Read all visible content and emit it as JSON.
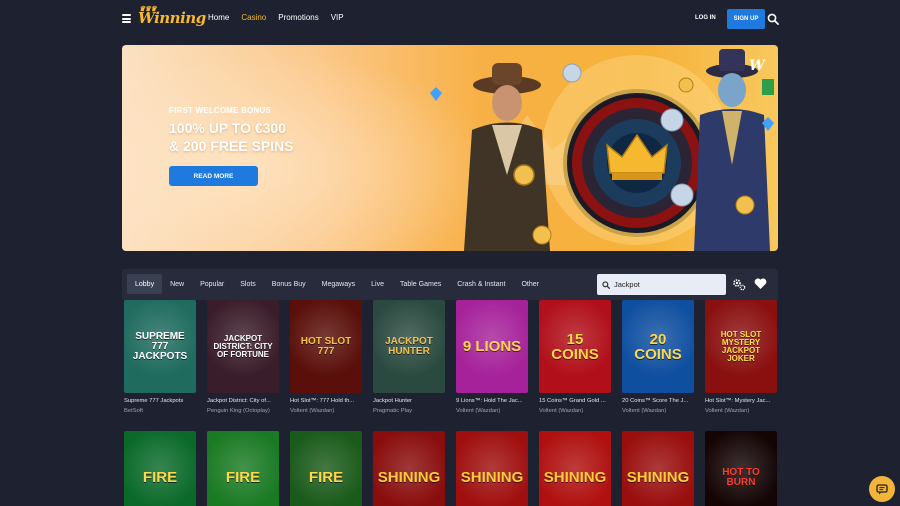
{
  "header": {
    "logo_text": "Winning",
    "nav": [
      {
        "label": "Home",
        "active": false
      },
      {
        "label": "Casino",
        "active": true
      },
      {
        "label": "Promotions",
        "active": false
      },
      {
        "label": "VIP",
        "active": false
      }
    ],
    "login_label": "LOG IN",
    "signup_label": "SIGN UP"
  },
  "banner": {
    "subtitle": "FIRST WELCOME BONUS",
    "headline_1": "100% UP TO €300",
    "headline_2": "& 200 FREE SPINS",
    "cta_label": "READ MORE"
  },
  "filters": {
    "tabs": [
      {
        "label": "Lobby",
        "active": true
      },
      {
        "label": "New"
      },
      {
        "label": "Popular"
      },
      {
        "label": "Slots"
      },
      {
        "label": "Bonus Buy"
      },
      {
        "label": "Megaways"
      },
      {
        "label": "Live"
      },
      {
        "label": "Table Games"
      },
      {
        "label": "Crash & Instant"
      },
      {
        "label": "Other"
      }
    ],
    "search_value": "Jackpot"
  },
  "games_row1": [
    {
      "name": "Supreme 777 Jackpots",
      "provider": "BetSoft",
      "art": "SUPREME 777 JACKPOTS",
      "bg": "#1f6b5e",
      "fg": "#ffffff"
    },
    {
      "name": "Jackpot District: City of...",
      "provider": "Penguin King (Octoplay)",
      "art": "JACKPOT DISTRICT: CITY OF FORTUNE",
      "bg": "#3a1d2a",
      "fg": "#ffffff"
    },
    {
      "name": "Hot Slot™: 777 Hold th...",
      "provider": "Voltent (Wazdan)",
      "art": "HOT SLOT 777",
      "bg": "#5a0f0a",
      "fg": "#f7c340"
    },
    {
      "name": "Jackpot Hunter",
      "provider": "Pragmatic Play",
      "art": "JACKPOT HUNTER",
      "bg": "#2b4a3f",
      "fg": "#f2c04e"
    },
    {
      "name": "9 Lions™: Hold The Jac...",
      "provider": "Voltent (Wazdan)",
      "art": "9 LIONS",
      "bg": "#a6229a",
      "fg": "#ffd84a"
    },
    {
      "name": "15 Coins™ Grand Gold ...",
      "provider": "Voltent (Wazdan)",
      "art": "15 COINS",
      "bg": "#b10f1a",
      "fg": "#ffd84a"
    },
    {
      "name": "20 Coins™ Score The J...",
      "provider": "Voltent (Wazdan)",
      "art": "20 COINS",
      "bg": "#0f4fa0",
      "fg": "#ffd84a"
    },
    {
      "name": "Hot Slot™: Mystery Jac...",
      "provider": "Voltent (Wazdan)",
      "art": "HOT SLOT MYSTERY JACKPOT JOKER",
      "bg": "#8a1010",
      "fg": "#ffe04a"
    }
  ],
  "games_row2": [
    {
      "art": "FIRE",
      "bg": "#0b6a2a",
      "fg": "#ffd84a"
    },
    {
      "art": "FIRE",
      "bg": "#1a7a24",
      "fg": "#ffd84a"
    },
    {
      "art": "FIRE",
      "bg": "#1a5a1a",
      "fg": "#ffd84a"
    },
    {
      "art": "SHINING",
      "bg": "#8a0d0d",
      "fg": "#ffcf3a"
    },
    {
      "art": "SHINING",
      "bg": "#a00f0f",
      "fg": "#ffcf3a"
    },
    {
      "art": "SHINING",
      "bg": "#b01010",
      "fg": "#ffcf3a"
    },
    {
      "art": "SHINING",
      "bg": "#9a0e0e",
      "fg": "#ffcf3a"
    },
    {
      "art": "HOT TO BURN",
      "bg": "#140505",
      "fg": "#ff3b2e"
    }
  ],
  "colors": {
    "background": "#1e2130",
    "accent": "#f5b82e",
    "primary_button": "#1f7ae0"
  }
}
